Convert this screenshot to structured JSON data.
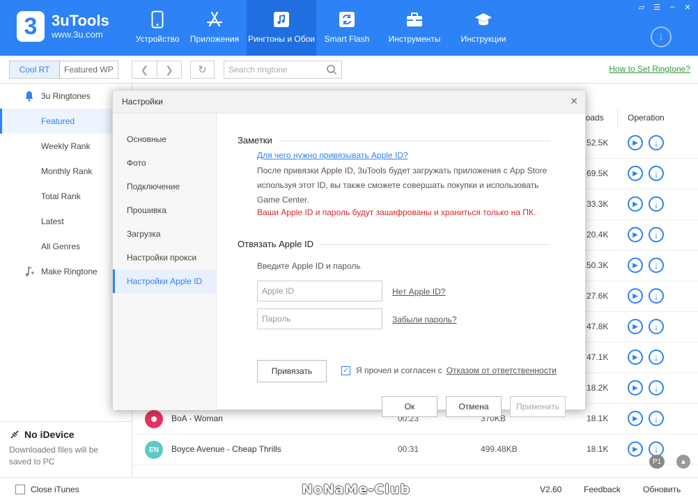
{
  "app": {
    "name": "3uTools",
    "url": "www.3u.com",
    "logo_digit": "3"
  },
  "nav": [
    {
      "label": "Устройство",
      "icon": "phone-icon"
    },
    {
      "label": "Приложения",
      "icon": "app-store-icon"
    },
    {
      "label": "Рингтоны и Обои",
      "icon": "music-icon"
    },
    {
      "label": "Smart Flash",
      "icon": "flash-icon"
    },
    {
      "label": "Инструменты",
      "icon": "toolbox-icon"
    },
    {
      "label": "Инструкции",
      "icon": "graduation-cap-icon"
    }
  ],
  "toolbar": {
    "tab_cool_rt": "Cool RT",
    "tab_featured_wp": "Featured WP",
    "search_placeholder": "Search ringtone",
    "how_to_link": "How to Set Ringtone?"
  },
  "sidebar": {
    "items": [
      {
        "label": "3u Ringtones"
      },
      {
        "label": "Featured"
      },
      {
        "label": "Weekly Rank"
      },
      {
        "label": "Monthly Rank"
      },
      {
        "label": "Total Rank"
      },
      {
        "label": "Latest"
      },
      {
        "label": "All Genres"
      },
      {
        "label": "Make Ringtone"
      }
    ],
    "device_title": "No iDevice",
    "device_sub": "Downloaded files will be saved to PC"
  },
  "list": {
    "col_downloads": "loads",
    "col_operation": "Operation",
    "rows": [
      {
        "downloads": "52.5K"
      },
      {
        "downloads": "69.5K"
      },
      {
        "downloads": "33.3K"
      },
      {
        "downloads": "20.4K"
      },
      {
        "downloads": "50.3K"
      },
      {
        "downloads": "27.6K"
      },
      {
        "downloads": "47.8K"
      },
      {
        "downloads": "47.1K"
      },
      {
        "downloads": "18.2K"
      },
      {
        "title": "BoA - Woman",
        "duration": "00:23",
        "size": "370KB",
        "downloads": "18.1K",
        "avatar_color": "#e8315f"
      },
      {
        "title": "Boyce Avenue - Cheap Thrills",
        "duration": "00:31",
        "size": "499.48KB",
        "downloads": "18.1K",
        "avatar": "EN",
        "avatar_color": "#5ec9c3"
      }
    ],
    "page_badge": "P1"
  },
  "status": {
    "close_itunes": "Close iTunes",
    "watermark": "NoNaMe-Club",
    "version": "V2.60",
    "feedback": "Feedback",
    "update": "Обновить"
  },
  "modal": {
    "title": "Настройки",
    "nav": [
      {
        "label": "Основные"
      },
      {
        "label": "Фото"
      },
      {
        "label": "Подключение"
      },
      {
        "label": "Прошивка"
      },
      {
        "label": "Загрузка"
      },
      {
        "label": "Настройки прокси"
      },
      {
        "label": "Настройки Apple ID"
      }
    ],
    "notes_title": "Заметки",
    "why_link": "Для чего нужно привязывать Apple ID?",
    "note_text": "После привязки Apple ID, 3uTools будет загружать приложения с App Store используя этот ID, вы также сможете совершать покупки и использовать Game Center.",
    "note_red": "Ваши Apple ID и пароль будут зашифрованы и храниться только на ПК.",
    "unbind_title": "Отвязать Apple ID",
    "enter_label": "Введите Apple ID и пароль",
    "appleid_placeholder": "Apple ID",
    "password_placeholder": "Пароль",
    "no_appleid_link": "Нет Apple ID?",
    "forgot_link": "Забыли пароль?",
    "bind_button": "Привязать",
    "agree_text": "Я прочел и согласен с",
    "disclaimer_link": "Отказом от ответственности",
    "ok": "Ок",
    "cancel": "Отмена",
    "apply": "Применить"
  }
}
